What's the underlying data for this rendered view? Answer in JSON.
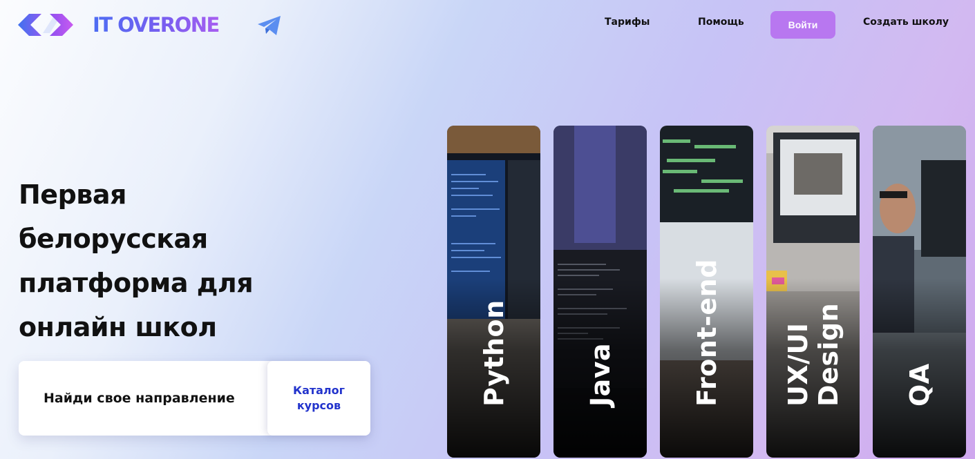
{
  "header": {
    "logo_text": "IT OVERONE",
    "nav": [
      "Тарифы",
      "Помощь"
    ],
    "login_label": "Войти",
    "create_label": "Создать школу"
  },
  "hero": {
    "lines": [
      "Первая",
      "белорусская",
      "платформа для",
      "онлайн школ"
    ]
  },
  "search": {
    "prompt": "Найди свое направление",
    "catalog_label": "Каталог\nкурсов"
  },
  "courses": [
    {
      "label": "Python"
    },
    {
      "label": "Java"
    },
    {
      "label": "Front-end"
    },
    {
      "label": "UX/UI\nDesign"
    },
    {
      "label": "QA"
    }
  ],
  "colors": {
    "accent": "#b877f0",
    "link": "#2233cc",
    "logo_gradient": [
      "#4d6cf2",
      "#a75ef0"
    ],
    "telegram": "#5b8ef0"
  },
  "icons": {
    "logo": "chevron-diamond-logo-icon",
    "telegram": "telegram-icon"
  }
}
